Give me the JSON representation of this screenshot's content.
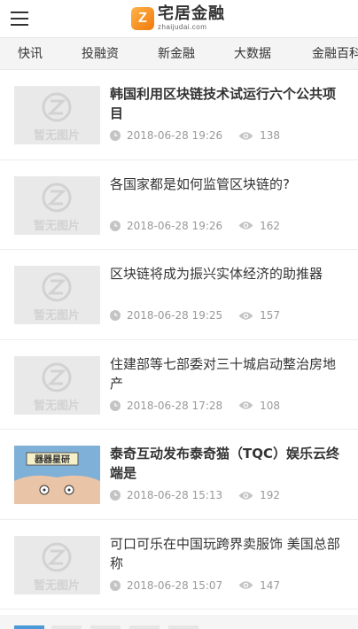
{
  "header": {
    "logo_mark": "Z",
    "logo_cn": "宅居金融",
    "logo_en": "zhaijudai.com"
  },
  "nav": {
    "items": [
      "快讯",
      "投融资",
      "新金融",
      "大数据",
      "金融百科"
    ]
  },
  "placeholder_text": "暂无图片",
  "comic_caption": "器器星研",
  "articles": [
    {
      "title": "韩国利用区块链技术试运行六个公共项目",
      "date": "2018-06-28 19:26",
      "views": "138",
      "bold": true
    },
    {
      "title": "各国家都是如何监管区块链的?",
      "date": "2018-06-28 19:26",
      "views": "162",
      "bold": false
    },
    {
      "title": "区块链将成为振兴实体经济的助推器",
      "date": "2018-06-28 19:25",
      "views": "157",
      "bold": false
    },
    {
      "title": "住建部等七部委对三十城启动整治房地产",
      "date": "2018-06-28 17:28",
      "views": "108",
      "bold": false
    },
    {
      "title": "泰奇互动发布泰奇猫（TQC）娱乐云终端是",
      "date": "2018-06-28 15:13",
      "views": "192",
      "bold": true
    },
    {
      "title": "可口可乐在中国玩跨界卖服饰 美国总部称",
      "date": "2018-06-28 15:07",
      "views": "147",
      "bold": false
    }
  ],
  "colors": {
    "accent": "#4a9ad8",
    "logo_orange": "#f07a0a"
  }
}
